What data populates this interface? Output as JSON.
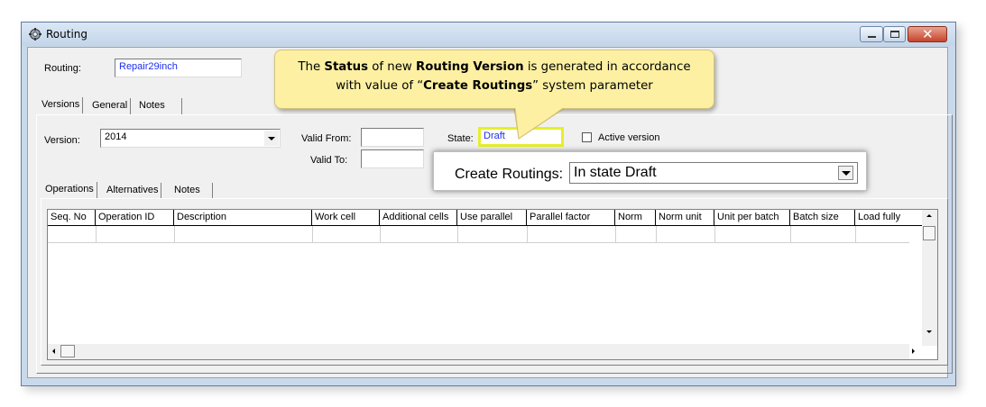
{
  "window": {
    "title": "Routing"
  },
  "routing": {
    "label": "Routing:",
    "value": "Repair29inch"
  },
  "top_tabs": [
    {
      "label": "Versions"
    },
    {
      "label": "General"
    },
    {
      "label": "Notes"
    }
  ],
  "version": {
    "label": "Version:",
    "value": "2014",
    "valid_from_label": "Valid From:",
    "valid_to_label": "Valid To:",
    "state_label": "State:",
    "state_value": "Draft",
    "active_label": "Active version"
  },
  "inner_tabs": [
    {
      "label": "Operations"
    },
    {
      "label": "Alternatives"
    },
    {
      "label": "Notes"
    }
  ],
  "table": {
    "columns": [
      "Seq. No",
      "Operation ID",
      "Description",
      "Work cell",
      "Additional cells",
      "Use parallel",
      "Parallel factor",
      "Norm",
      "Norm unit",
      "Unit per batch",
      "Batch size",
      "Load fully"
    ]
  },
  "callout": {
    "p1": "The ",
    "b1": "Status",
    "p2": " of new ",
    "b2": "Routing Version",
    "p3": " is generated in accordance",
    "p4": "with value of “",
    "b3": "Create Routings",
    "p5": "” system parameter"
  },
  "create_routings": {
    "label": "Create Routings:",
    "value": "In state Draft"
  },
  "colors": {
    "title_bar": "#c9d9ec",
    "close_button": "#c6442b",
    "callout_bg": "#fdf0a2",
    "highlight": "#e6ef2a",
    "value_text": "#1d2ef0"
  }
}
